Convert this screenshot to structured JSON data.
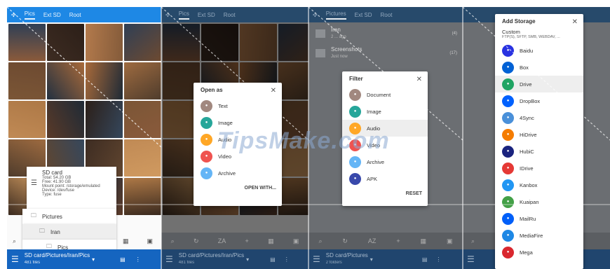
{
  "panel1": {
    "tabs": [
      "Pics",
      "Ext SD",
      "Root"
    ],
    "path": "SD card/Pictures/Iran/Pics",
    "files": "481 files",
    "storage_card": {
      "title": "SD card",
      "lines": [
        "Total: 54.20 GB",
        "Free: 41.90 GB",
        "Mount point: /storage/emulated",
        "Device: /dev/fuse",
        "Type: fuse"
      ]
    },
    "folders": [
      "Pictures",
      "Iran",
      "Pics"
    ]
  },
  "panel2": {
    "tabs": [
      "Pics",
      "Ext SD",
      "Root"
    ],
    "path": "SD card/Pictures/Iran/Pics",
    "files": "481 files",
    "toolbar": [
      "ZA"
    ],
    "dialog": {
      "title": "Open as",
      "items": [
        {
          "label": "Text",
          "color": "#a1887f",
          "icon": "text-icon"
        },
        {
          "label": "Image",
          "color": "#26a69a",
          "icon": "image-icon"
        },
        {
          "label": "Audio",
          "color": "#ffa726",
          "icon": "audio-icon"
        },
        {
          "label": "Video",
          "color": "#ef5350",
          "icon": "video-icon"
        },
        {
          "label": "Archive",
          "color": "#64b5f6",
          "icon": "archive-icon"
        }
      ],
      "button": "OPEN WITH..."
    }
  },
  "panel3": {
    "tabs": [
      "Pictures",
      "Ext SD",
      "Root"
    ],
    "path": "SD card/Pictures",
    "files": "2 folders",
    "rows": [
      {
        "title": "Iran",
        "sub": "2 ... ago",
        "count": "(4)"
      },
      {
        "title": "Screenshots",
        "sub": "Just now",
        "count": "(17)"
      }
    ],
    "toolbar": [
      "AZ"
    ],
    "dialog": {
      "title": "Filter",
      "items": [
        {
          "label": "Document",
          "color": "#a1887f",
          "icon": "document-icon"
        },
        {
          "label": "Image",
          "color": "#26a69a",
          "icon": "image-icon"
        },
        {
          "label": "Audio",
          "color": "#ffa726",
          "icon": "audio-icon",
          "selected": true
        },
        {
          "label": "Video",
          "color": "#ef5350",
          "icon": "video-icon"
        },
        {
          "label": "Archive",
          "color": "#64b5f6",
          "icon": "archive-icon"
        },
        {
          "label": "APK",
          "color": "#3949ab",
          "icon": "android-icon"
        }
      ],
      "button": "RESET"
    }
  },
  "panel4": {
    "dialog": {
      "title": "Add Storage",
      "custom_title": "Custom",
      "custom_sub": "FTP(S), SFTP, SMB, WEBDAV, ...",
      "items": [
        {
          "label": "Baidu",
          "color": "#2932e1",
          "icon": "baidu-icon"
        },
        {
          "label": "Box",
          "color": "#0061d5",
          "icon": "box-icon"
        },
        {
          "label": "Drive",
          "color": "#1fa463",
          "icon": "drive-icon",
          "selected": true
        },
        {
          "label": "DropBox",
          "color": "#0061fe",
          "icon": "dropbox-icon"
        },
        {
          "label": "4Sync",
          "color": "#4a90d9",
          "icon": "4sync-icon"
        },
        {
          "label": "HiDrive",
          "color": "#f57c00",
          "icon": "hidrive-icon"
        },
        {
          "label": "HubiC",
          "color": "#1a237e",
          "icon": "hubic-icon"
        },
        {
          "label": "IDrive",
          "color": "#e53935",
          "icon": "idrive-icon"
        },
        {
          "label": "Kanbox",
          "color": "#2196f3",
          "icon": "kanbox-icon"
        },
        {
          "label": "Kuaipan",
          "color": "#43a047",
          "icon": "kuaipan-icon"
        },
        {
          "label": "MailRu",
          "color": "#005ff9",
          "icon": "mailru-icon"
        },
        {
          "label": "MediaFire",
          "color": "#1e88e5",
          "icon": "mediafire-icon"
        },
        {
          "label": "Mega",
          "color": "#d9272e",
          "icon": "mega-icon"
        }
      ]
    }
  },
  "watermark": "TipsMake.com"
}
